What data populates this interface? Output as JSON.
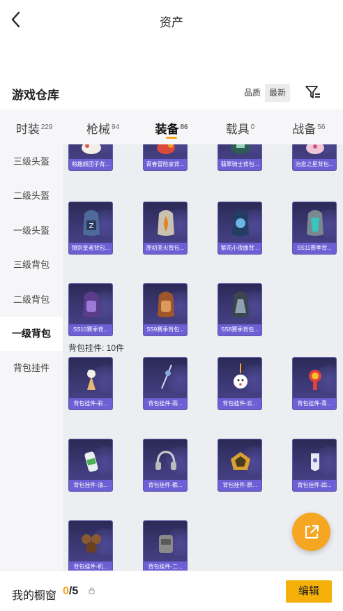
{
  "header": {
    "title": "资产",
    "back_icon": "chevron-left-icon"
  },
  "section": {
    "title": "游戏仓库",
    "sort_options": [
      "品质",
      "最新"
    ],
    "sort_selected": "最新",
    "filter_icon": "filter-icon"
  },
  "tabs": [
    {
      "label": "时装",
      "count": "229"
    },
    {
      "label": "枪械",
      "count": "94"
    },
    {
      "label": "装备",
      "count": "86",
      "active": true
    },
    {
      "label": "载具",
      "count": "0"
    },
    {
      "label": "战备",
      "count": "56"
    }
  ],
  "sidebar": [
    {
      "label": "三级头盔"
    },
    {
      "label": "二级头盔"
    },
    {
      "label": "一级头盔"
    },
    {
      "label": "三级背包"
    },
    {
      "label": "二级背包"
    },
    {
      "label": "一级背包",
      "active": true
    },
    {
      "label": "背包挂件"
    }
  ],
  "backpacks_row1": [
    "萌趣颜团子背...",
    "青春冒险家背...",
    "翡翠骑士背包...",
    "治愈之星背包..."
  ],
  "backpacks_row2": [
    "锦别皇者背包...",
    "原初圣火背包...",
    "紫花小夜曲背...",
    "SS11赛季背..."
  ],
  "backpacks_row3": [
    "SS10赛季背...",
    "SS9赛季背包...",
    "SS8赛季背包..."
  ],
  "charms_group": {
    "label": "背包挂件: 10件"
  },
  "charms_row1": [
    "背包挂件-彩...",
    "背包挂件-雨...",
    "背包挂件-云...",
    "背包挂件-青..."
  ],
  "charms_row2": [
    "背包挂件-油...",
    "背包挂件-礁...",
    "背包挂件-原...",
    "背包挂件-四..."
  ],
  "charms_row3": [
    "背包挂件-机...",
    "背包挂件-二..."
  ],
  "share_icon": "share-external-icon",
  "bottom": {
    "label": "我的橱窗",
    "current": "0",
    "separator": "/",
    "total": "5",
    "lock_icon": "lock-icon",
    "edit_label": "编辑"
  },
  "colors": {
    "accent": "#f5a623",
    "card_label": "#6d5fd4",
    "card_bg": "#3e3a78"
  }
}
